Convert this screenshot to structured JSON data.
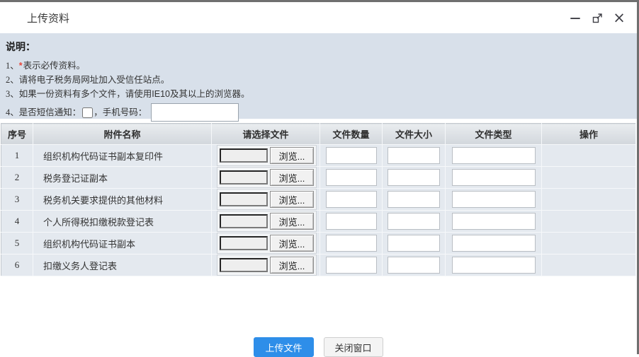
{
  "window": {
    "title": "上传资料",
    "icons": {
      "minimize": "—",
      "close": "×",
      "maximize_name": "expand-icon"
    }
  },
  "instructions": {
    "heading": "说明：",
    "items": [
      {
        "num": "1、",
        "star": "*",
        "text": "表示必传资料。"
      },
      {
        "num": "2、",
        "star": "",
        "text": "请将电子税务局网址加入受信任站点。"
      },
      {
        "num": "3、",
        "star": "",
        "text": "如果一份资料有多个文件，请使用IE10及其以上的浏览器。"
      }
    ],
    "line4": {
      "num": "4、",
      "sms_label": "是否短信通知：",
      "checkbox_checked": false,
      "comma": "，",
      "phone_label": "手机号码：",
      "phone_value": ""
    }
  },
  "table": {
    "headers": [
      "序号",
      "附件名称",
      "请选择文件",
      "文件数量",
      "文件大小",
      "文件类型",
      "操作"
    ],
    "browse_label": "浏览...",
    "rows": [
      {
        "no": "1",
        "name": "组织机构代码证书副本复印件",
        "file_value": "",
        "quantity": "",
        "size": "",
        "type": ""
      },
      {
        "no": "2",
        "name": "税务登记证副本",
        "file_value": "",
        "quantity": "",
        "size": "",
        "type": ""
      },
      {
        "no": "3",
        "name": "税务机关要求提供的其他材料",
        "file_value": "",
        "quantity": "",
        "size": "",
        "type": ""
      },
      {
        "no": "4",
        "name": "个人所得税扣缴税款登记表",
        "file_value": "",
        "quantity": "",
        "size": "",
        "type": ""
      },
      {
        "no": "5",
        "name": "组织机构代码证书副本",
        "file_value": "",
        "quantity": "",
        "size": "",
        "type": ""
      },
      {
        "no": "6",
        "name": "扣缴义务人登记表",
        "file_value": "",
        "quantity": "",
        "size": "",
        "type": ""
      }
    ]
  },
  "footer": {
    "upload_label": "上传文件",
    "close_label": "关闭窗口"
  },
  "colors": {
    "accent_blue": "#2e8ee9",
    "panel_bg": "#d8e0ea",
    "table_row_bg": "#e4e9ef",
    "required_star": "#e8473b",
    "frame_border": "#6f6f6f"
  }
}
